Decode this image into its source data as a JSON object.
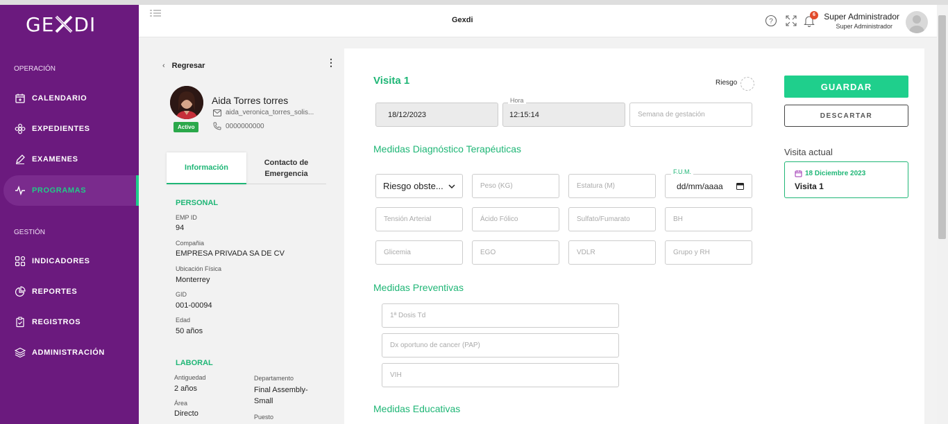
{
  "app": {
    "logo_text_left": "GE",
    "logo_text_right": "DI",
    "header_title": "Gexdi",
    "notification_count": "6",
    "user_name": "Super Administrador",
    "user_role": "Super Administrador"
  },
  "sidebar": {
    "section_operacion": "OPERACIÓN",
    "section_gestion": "GESTIÓN",
    "items": [
      {
        "label": "CALENDARIO",
        "icon": "calendar-plus-icon"
      },
      {
        "label": "EXPEDIENTES",
        "icon": "flower-icon"
      },
      {
        "label": "EXAMENES",
        "icon": "pen-icon"
      },
      {
        "label": "PROGRAMAS",
        "icon": "pulse-icon",
        "active": true
      },
      {
        "label": "INDICADORES",
        "icon": "grid-icon"
      },
      {
        "label": "REPORTES",
        "icon": "pie-chart-icon"
      },
      {
        "label": "REGISTROS",
        "icon": "clipboard-check-icon"
      },
      {
        "label": "ADMINISTRACIÓN",
        "icon": "layers-icon"
      }
    ],
    "accent_color": "#1fcf8c",
    "background_color": "#6b1a7e"
  },
  "patient": {
    "back_label": "Regresar",
    "name": "Aida Torres torres",
    "email": "aida_veronica_torres_solis...",
    "phone": "0000000000",
    "status": "Activo",
    "tabs": [
      "Información",
      "Contacto de Emergencia"
    ],
    "personal_title": "PERSONAL",
    "personal": [
      {
        "label": "EMP ID",
        "value": "94"
      },
      {
        "label": "Compañia",
        "value": "EMPRESA PRIVADA SA DE CV"
      },
      {
        "label": "Ubicación Física",
        "value": "Monterrey"
      },
      {
        "label": "GID",
        "value": "001-00094"
      },
      {
        "label": "Edad",
        "value": "50 años"
      }
    ],
    "laboral_title": "LABORAL",
    "laboral": {
      "antiguedad_label": "Antiguedad",
      "antiguedad_value": "2 años",
      "departamento_label": "Departamento",
      "departamento_value_1": "Final Assembly-",
      "departamento_value_2": "Small",
      "area_label": "Área",
      "area_value": "Directo",
      "puesto_label": "Puesto"
    }
  },
  "visit": {
    "title": "Visita 1",
    "riesgo_label": "Riesgo",
    "date_value": "18/12/2023",
    "hora_label": "Hora",
    "hora_value": "12:15:14",
    "semana_placeholder": "Semana de gestación",
    "diag_title": "Medidas Diagnóstico Terapéuticas",
    "riesgo_select": "Riesgo obste...",
    "peso_placeholder": "Peso (KG)",
    "estatura_placeholder": "Estatura (M)",
    "fum_label": "F.U.M.",
    "fum_placeholder": "dd/mm/aaaa",
    "tension_placeholder": "Tensión Arterial",
    "acido_placeholder": "Ácido Fólico",
    "sulfato_placeholder": "Sulfato/Fumarato",
    "bh_placeholder": "BH",
    "glicemia_placeholder": "Glicemia",
    "ego_placeholder": "EGO",
    "vdlr_placeholder": "VDLR",
    "grupo_placeholder": "Grupo y RH",
    "prev_title": "Medidas Preventivas",
    "dosis_placeholder": "1ª Dosis Td",
    "dx_placeholder": "Dx oportuno de cancer (PAP)",
    "vih_placeholder": "VIH",
    "edu_title": "Medidas Educativas",
    "save_label": "GUARDAR",
    "discard_label": "DESCARTAR",
    "current_visit_label": "Visita actual",
    "current_visit_date": "18 Diciembre 2023",
    "current_visit_name": "Visita 1"
  }
}
